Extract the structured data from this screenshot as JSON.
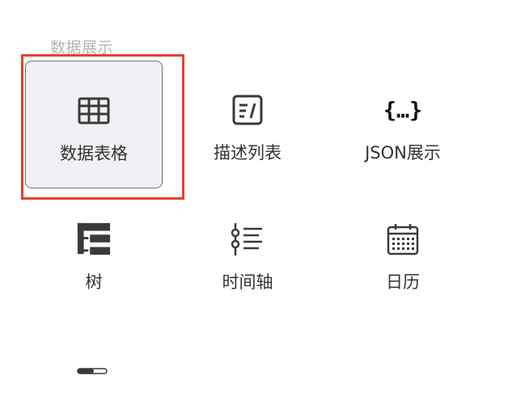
{
  "section": {
    "title": "数据展示"
  },
  "components": [
    {
      "label": "数据表格",
      "icon": "table-icon",
      "selected": true
    },
    {
      "label": "描述列表",
      "icon": "description-list-icon"
    },
    {
      "label": "JSON展示",
      "icon": "json-braces-icon"
    },
    {
      "label": "树",
      "icon": "tree-icon"
    },
    {
      "label": "时间轴",
      "icon": "timeline-icon"
    },
    {
      "label": "日历",
      "icon": "calendar-icon"
    }
  ],
  "partial_item": {
    "icon": "progress-bar-icon"
  },
  "colors": {
    "highlight": "#e5402a",
    "selected_bg": "#f0f1f5",
    "icon": "#3a3a3a"
  }
}
